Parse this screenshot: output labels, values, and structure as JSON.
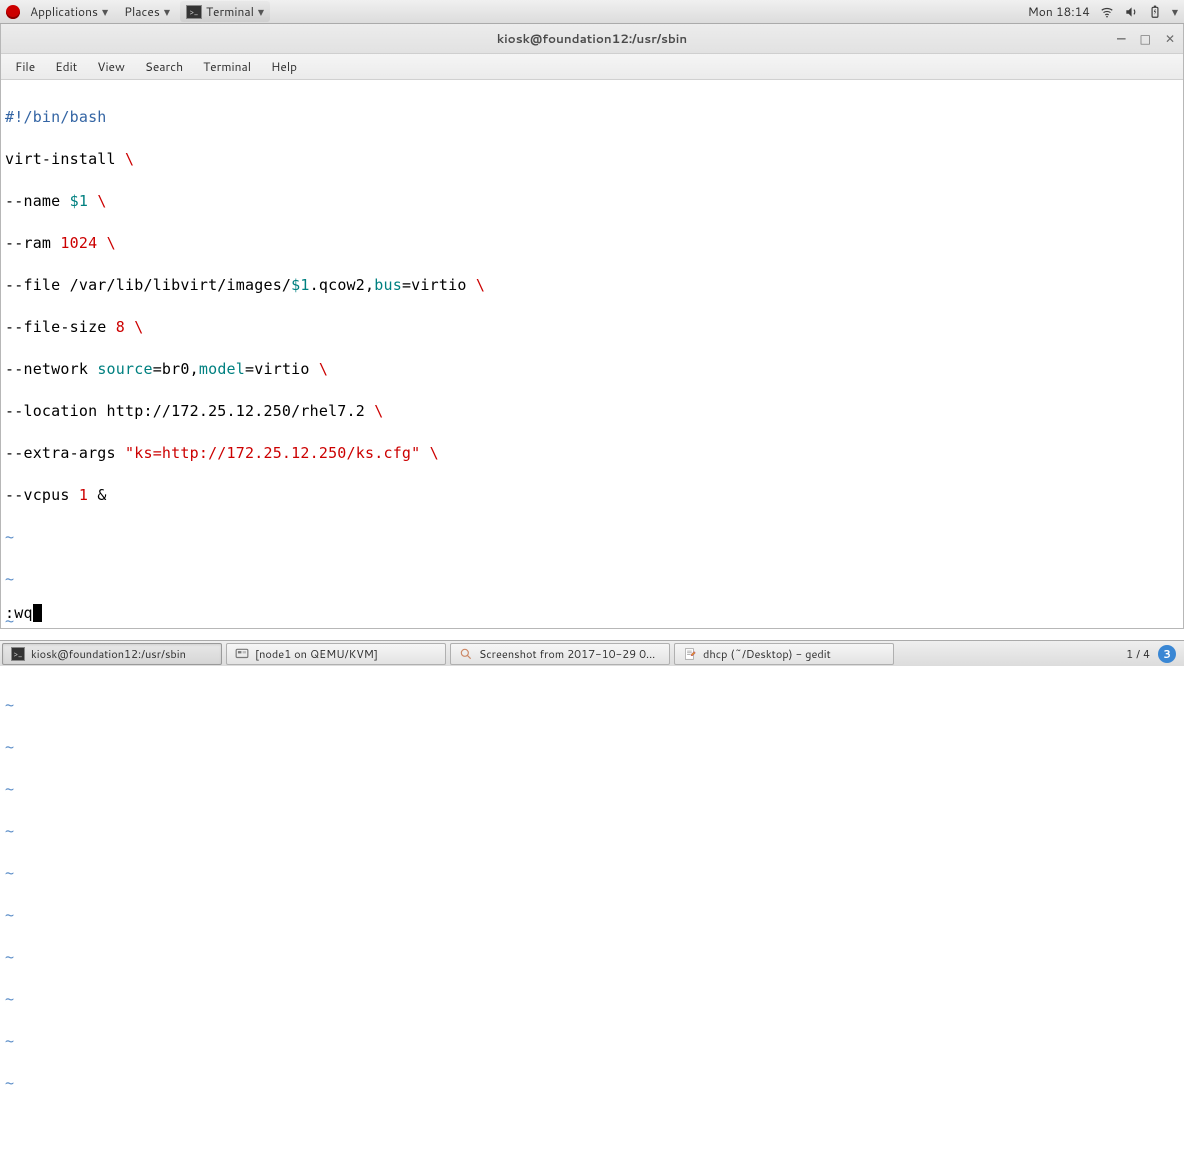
{
  "top_panel": {
    "applications": "Applications",
    "places": "Places",
    "terminal": "Terminal",
    "clock": "Mon 18:14"
  },
  "window": {
    "title": "kiosk@foundation12:/usr/sbin"
  },
  "menubar": {
    "file": "File",
    "edit": "Edit",
    "view": "View",
    "search": "Search",
    "terminal": "Terminal",
    "help": "Help"
  },
  "editor": {
    "shebang": "#!/bin/bash",
    "l2a": "virt-install ",
    "l3a": "--name ",
    "l3b": "$1",
    "l3c": " ",
    "l4a": "--ram ",
    "l4b": "1024",
    "l4c": " ",
    "l5a": "--file /var/lib/libvirt/images/",
    "l5b": "$1",
    "l5c": ".qcow2,",
    "l5d": "bus",
    "l5e": "=virtio ",
    "l6a": "--file-size ",
    "l6b": "8",
    "l6c": " ",
    "l7a": "--network ",
    "l7b": "source",
    "l7c": "=br0,",
    "l7d": "model",
    "l7e": "=virtio ",
    "l8a": "--location http://172.25.12.250/rhel7.2 ",
    "l9a": "--extra-args ",
    "l9b": "\"ks=http://172.25.12.250/ks.cfg\"",
    "l9c": " ",
    "l10a": "--vcpus ",
    "l10b": "1",
    "l10c": " &",
    "bs": "\\",
    "tilde": "~",
    "cmd": ":wq"
  },
  "taskbar": {
    "t1": "kiosk@foundation12:/usr/sbin",
    "t2": "[node1 on QEMU/KVM]",
    "t3": "Screenshot from 2017-10-29 0...",
    "t4": "dhcp (~/Desktop) - gedit",
    "ws": "1 / 4",
    "notif": "3"
  }
}
